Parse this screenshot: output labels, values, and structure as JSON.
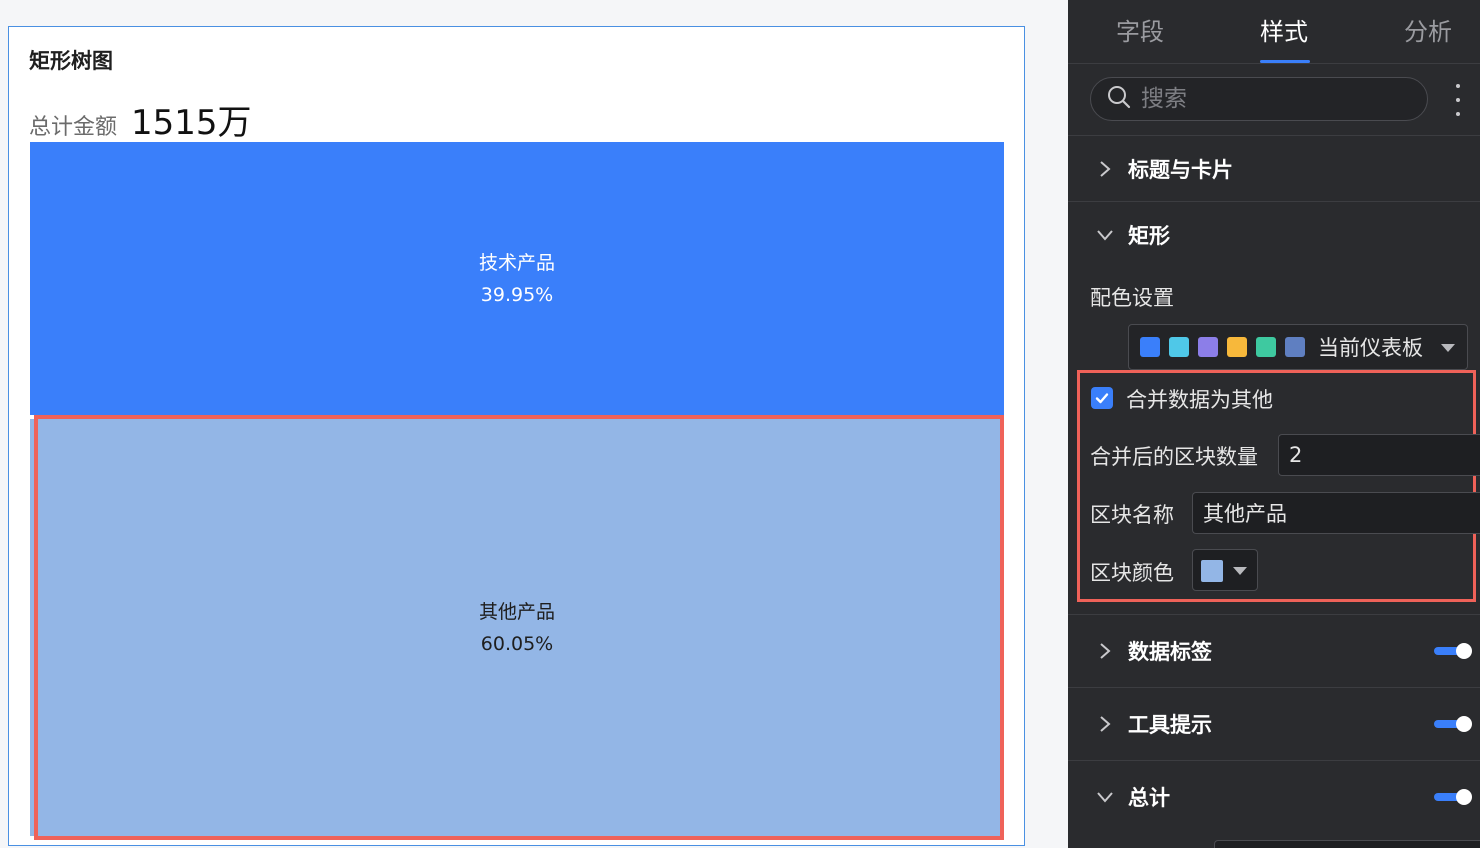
{
  "chart": {
    "title": "矩形树图",
    "total_label": "总计金额",
    "total_value": "1515万"
  },
  "chart_data": {
    "type": "treemap",
    "title": "矩形树图",
    "categories": [
      "技术产品",
      "其他产品"
    ],
    "values": [
      39.95,
      60.05
    ],
    "value_labels": [
      "39.95%",
      "60.05%"
    ],
    "colors": [
      "#3a7ffa",
      "#93b6e6"
    ]
  },
  "panel": {
    "tabs": [
      {
        "label": "字段",
        "active": false
      },
      {
        "label": "样式",
        "active": true
      },
      {
        "label": "分析",
        "active": false
      }
    ],
    "search_placeholder": "搜索",
    "sections": {
      "title_card": "标题与卡片",
      "rect": "矩形",
      "data_label": "数据标签",
      "tooltip": "工具提示",
      "total": "总计"
    },
    "color_setting_label": "配色设置",
    "palette": {
      "name": "当前仪表板",
      "swatches": [
        "#3a7ffa",
        "#4fc8e8",
        "#8c7ee8",
        "#f7b83b",
        "#3ec9a0",
        "#5f7fc1"
      ]
    },
    "merge_checkbox_label": "合并数据为其他",
    "merge_checked": true,
    "block_count_label": "合并后的区块数量",
    "block_count_value": "2",
    "block_name_label": "区块名称",
    "block_name_value": "其他产品",
    "block_color_label": "区块颜色",
    "block_color": "#93b6e6",
    "toggles": {
      "data_label": true,
      "tooltip": true,
      "total": true
    }
  }
}
